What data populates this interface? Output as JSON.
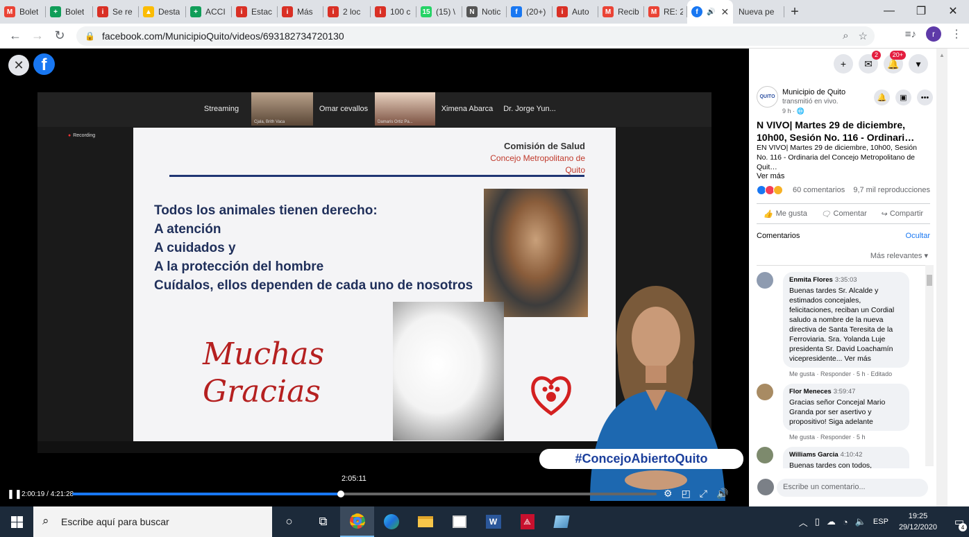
{
  "browser": {
    "tabs": [
      {
        "title": "Bolet",
        "icon": "gmail-icon",
        "color": "#ea4335",
        "glyph": "M"
      },
      {
        "title": "Bolet",
        "icon": "sheets-icon",
        "color": "#0f9d58",
        "glyph": "+"
      },
      {
        "title": "Se re",
        "icon": "alert-icon",
        "color": "#d93025",
        "glyph": "i"
      },
      {
        "title": "Desta",
        "icon": "drive-icon",
        "color": "#fbbc04",
        "glyph": "▲"
      },
      {
        "title": "ACCI",
        "icon": "sheets-icon",
        "color": "#0f9d58",
        "glyph": "+"
      },
      {
        "title": "Estac",
        "icon": "alert-icon",
        "color": "#d93025",
        "glyph": "i"
      },
      {
        "title": "Más",
        "icon": "alert-icon",
        "color": "#d93025",
        "glyph": "i"
      },
      {
        "title": "2 loc",
        "icon": "alert-icon",
        "color": "#d93025",
        "glyph": "i"
      },
      {
        "title": "100 c",
        "icon": "alert-icon",
        "color": "#d93025",
        "glyph": "i"
      },
      {
        "title": "(15) \\",
        "icon": "whatsapp-icon",
        "color": "#25d366",
        "glyph": "15"
      },
      {
        "title": "Notic",
        "icon": "news-icon",
        "color": "#555555",
        "glyph": "N"
      },
      {
        "title": "(20+)",
        "icon": "facebook-icon",
        "color": "#1877f2",
        "glyph": "f"
      },
      {
        "title": "Auto",
        "icon": "alert-icon",
        "color": "#d93025",
        "glyph": "i"
      },
      {
        "title": "Recib",
        "icon": "gmail-icon",
        "color": "#ea4335",
        "glyph": "M"
      },
      {
        "title": "RE: 2",
        "icon": "gmail-icon",
        "color": "#ea4335",
        "glyph": "M"
      }
    ],
    "active_tab": {
      "icon": "facebook-icon",
      "color": "#1877f2",
      "glyph": "f",
      "audio": "🔊",
      "close": "✕"
    },
    "new_tab_page": "Nueva pe",
    "url": "facebook.com/MunicipioQuito/videos/693182734720130",
    "profile_initial": "r"
  },
  "zoom": {
    "participants": [
      {
        "label": "Streaming"
      },
      {
        "label": "Cjala, Brith Vaca"
      },
      {
        "label": "Omar cevallos"
      },
      {
        "label": "Damaris Ortiz Pa..."
      },
      {
        "label": "Ximena Abarca"
      },
      {
        "label": "Dr. Jorge Yun..."
      }
    ],
    "recording": "Recording"
  },
  "slide": {
    "commission": "Comisión de Salud",
    "council": [
      "Concejo Metropolitano de",
      "Quito"
    ],
    "rights": [
      "Todos los animales tienen derecho:",
      "A atención",
      "A cuidados  y",
      "A la protección del hombre",
      "Cuídalos, ellos dependen de cada uno de nosotros"
    ],
    "thanks": [
      "Muchas",
      "Gracias"
    ]
  },
  "hashtag": "#ConcejoAbiertoQuito",
  "player": {
    "hover_time": "2:05:11",
    "time": "2:00:19 / 4:21:28",
    "progress_percent": 46
  },
  "panel": {
    "messenger_badge": "2",
    "notif_badge": "20+",
    "page_name": "Municipio de Quito",
    "page_status": "transmitió en vivo.",
    "time_ago": "9 h · 🌐",
    "title": "N VIVO| Martes 29 de diciembre, 10h00, Sesión No. 116 - Ordinari…",
    "description": "EN VIVO| Martes 29 de diciembre, 10h00, Sesión No. 116 - Ordinaria del Concejo Metropolitano de Quit…",
    "see_more": "Ver más",
    "comments_count": "60 comentarios",
    "views": "9,7 mil reproducciones",
    "like": "Me gusta",
    "comment": "Comentar",
    "share": "Compartir",
    "comments_label": "Comentarios",
    "hide": "Ocultar",
    "sort": "Más relevantes",
    "comments": [
      {
        "author": "Enmita Flores",
        "time": "3:35:03",
        "text": "Buenas tardes Sr. Alcalde y estimados concejales, felicitaciones, reciban un Cordial saludo a nombre de la nueva directiva de Santa Teresita de la Ferroviaria. Sra. Yolanda Luje presidenta Sr. David Loachamín vicepresidente...",
        "more": " Ver más",
        "meta": "Me gusta · Responder · 5 h · Editado"
      },
      {
        "author": "Flor Meneces",
        "time": "3:59:47",
        "text": "Gracias señor Concejal Mario Granda por ser asertivo y propositivo! Siga adelante",
        "more": "",
        "meta": "Me gusta · Responder · 5 h"
      },
      {
        "author": "Williams Garcia",
        "time": "4:10:42",
        "text": "Buenas tardes con todos, considero que las rutas turísticas",
        "more": "",
        "meta": ""
      }
    ],
    "input_placeholder": "Escribe un comentario..."
  },
  "taskbar": {
    "search": "Escribe aquí para buscar",
    "lang": "ESP",
    "time": "19:25",
    "date": "29/12/2020",
    "notifications": "4"
  }
}
